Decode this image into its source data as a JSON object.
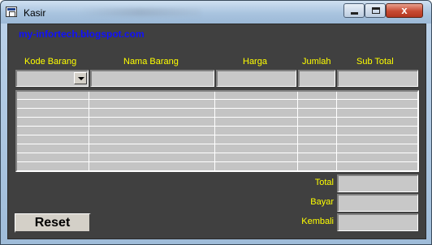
{
  "window": {
    "title": "Kasir",
    "controls": {
      "minimize": "",
      "maximize": "",
      "close": "x"
    }
  },
  "form": {
    "blog_link": "my-infortech.blogspot.com",
    "columns": [
      "Kode Barang",
      "Nama Barang",
      "Harga",
      "Jumlah",
      "Sub Total"
    ],
    "inputs": {
      "kode_barang": "",
      "nama_barang": "",
      "harga": "",
      "jumlah": "",
      "sub_total": ""
    },
    "grid": {
      "rows": [
        [
          "",
          "",
          "",
          "",
          ""
        ],
        [
          "",
          "",
          "",
          "",
          ""
        ],
        [
          "",
          "",
          "",
          "",
          ""
        ],
        [
          "",
          "",
          "",
          "",
          ""
        ],
        [
          "",
          "",
          "",
          "",
          ""
        ],
        [
          "",
          "",
          "",
          "",
          ""
        ],
        [
          "",
          "",
          "",
          "",
          ""
        ],
        [
          "",
          "",
          "",
          "",
          ""
        ],
        [
          "",
          "",
          "",
          "",
          ""
        ]
      ]
    },
    "summary": {
      "total_label": "Total",
      "bayar_label": "Bayar",
      "kembali_label": "Kembali",
      "total_value": "",
      "bayar_value": "",
      "kembali_value": ""
    },
    "reset_label": "Reset"
  },
  "colors": {
    "background": "#404040",
    "label": "#ffff00",
    "link": "#1010ff",
    "field": "#c8c8c8"
  },
  "icons": [
    "app-icon",
    "minimize-icon",
    "maximize-icon",
    "close-icon",
    "dropdown-arrow-icon"
  ]
}
